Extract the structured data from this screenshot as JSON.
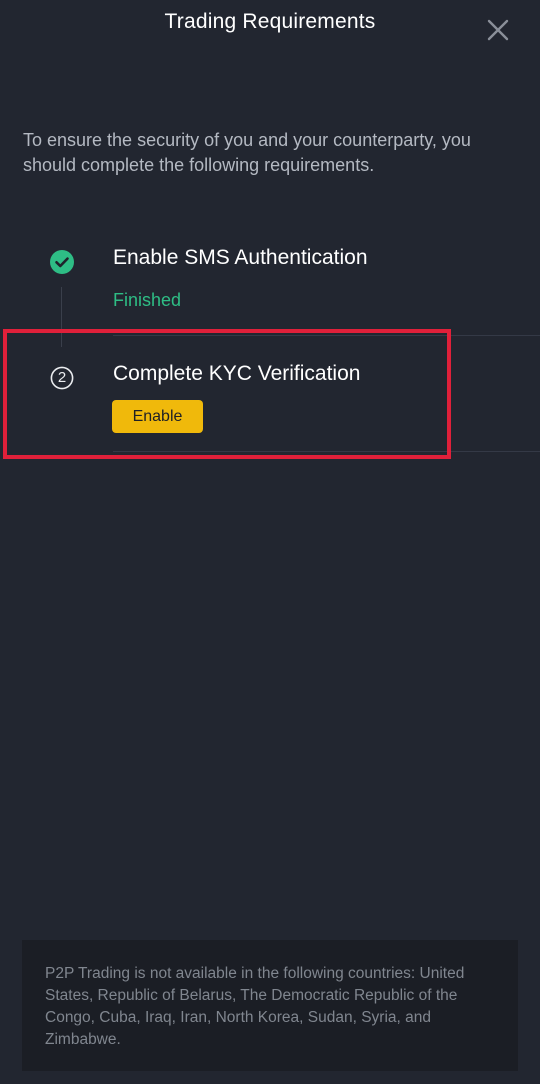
{
  "header": {
    "title": "Trading Requirements",
    "close_icon": "close-icon"
  },
  "intro_text": "To ensure the security of you and your counterparty, you should complete the following requirements.",
  "steps": [
    {
      "title": "Enable SMS Authentication",
      "status": "Finished",
      "icon": "check-circle-icon",
      "completed": true
    },
    {
      "title": "Complete KYC Verification",
      "number": "2",
      "icon": "step-number-icon",
      "action_label": "Enable",
      "completed": false
    }
  ],
  "notice": "P2P Trading is not available in the following countries: United States, Republic of Belarus, The Democratic Republic of the Congo, Cuba, Iraq, Iran, North Korea, Sudan, Syria, and Zimbabwe.",
  "colors": {
    "background": "#222630",
    "accent": "#f0b90b",
    "success": "#2ebd85",
    "highlight": "#e0203a"
  }
}
